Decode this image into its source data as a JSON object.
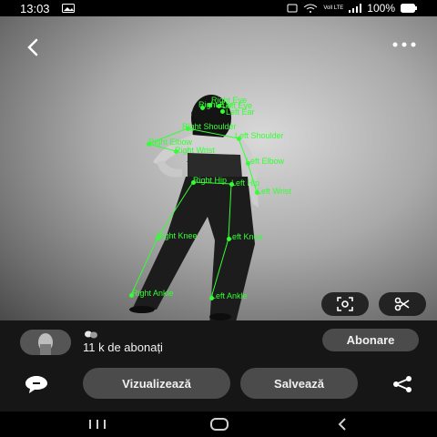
{
  "status": {
    "time": "13:03",
    "signal": "Voll LTE",
    "battery": "100%"
  },
  "photo": {
    "pose_labels": [
      "Right Eye",
      "Left Eye",
      "Right Ear",
      "Left Ear",
      "Right Shoulder",
      "Left Shoulder",
      "Right Elbow",
      "Right Wrist",
      "Left Elbow",
      "Right Hip",
      "Left Hip",
      "Left Wrist",
      "Right Knee",
      "Left Knee",
      "Right Ankle",
      "Left Ankle"
    ]
  },
  "profile": {
    "followers": "11 k de abonați"
  },
  "actions": {
    "subscribe_label": "Abonare",
    "view_label": "Vizualizează",
    "save_label": "Salvează"
  },
  "icons": {
    "back": "back-arrow-icon",
    "more": "more-dots-icon",
    "lens": "lens-search-icon",
    "cut": "scissors-icon",
    "comment": "comment-icon",
    "share": "share-icon"
  },
  "colors": {
    "pose": "#33ff33",
    "pill": "#4b4b4b",
    "panel": "#161616"
  }
}
